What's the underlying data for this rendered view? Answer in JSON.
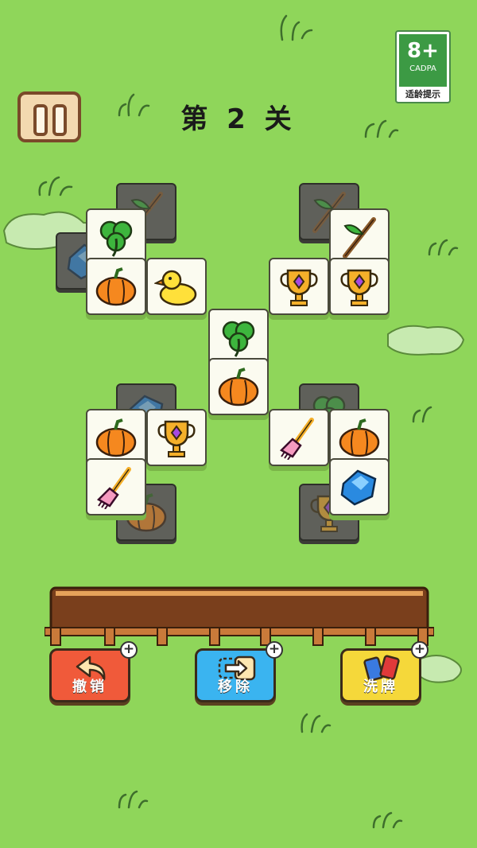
{
  "level": {
    "title": "第 2 关"
  },
  "age_rating": {
    "badge": "8+",
    "org": "CADPA",
    "tip": "适龄提示"
  },
  "pause_button": {
    "icon": "pause-icon"
  },
  "tray": {
    "label": "",
    "slots_filled": 0
  },
  "actions": [
    {
      "id": "undo",
      "label": "撤销",
      "icon": "undo-arrow-icon",
      "color": "#f05a3a"
    },
    {
      "id": "remove",
      "label": "移除",
      "icon": "remove-arrow-icon",
      "color": "#3ab4f0"
    },
    {
      "id": "shuffle",
      "label": "洗牌",
      "icon": "cards-icon",
      "color": "#f5d83a"
    }
  ],
  "tiles": [
    {
      "item": "twig",
      "state": "covered"
    },
    {
      "item": "gem",
      "state": "covered"
    },
    {
      "item": "clover",
      "state": "open"
    },
    {
      "item": "pumpkin",
      "state": "open"
    },
    {
      "item": "duck",
      "state": "open"
    },
    {
      "item": "twig",
      "state": "covered"
    },
    {
      "item": "twig",
      "state": "open"
    },
    {
      "item": "trophy",
      "state": "open"
    },
    {
      "item": "trophy",
      "state": "open"
    },
    {
      "item": "clover",
      "state": "open"
    },
    {
      "item": "pumpkin",
      "state": "open"
    },
    {
      "item": "gem",
      "state": "covered"
    },
    {
      "item": "clover",
      "state": "covered"
    },
    {
      "item": "pumpkin",
      "state": "open"
    },
    {
      "item": "trophy",
      "state": "open"
    },
    {
      "item": "broom",
      "state": "open"
    },
    {
      "item": "pumpkin",
      "state": "open"
    },
    {
      "item": "broom",
      "state": "open"
    },
    {
      "item": "gem",
      "state": "open"
    },
    {
      "item": "pumpkin",
      "state": "covered"
    },
    {
      "item": "trophy",
      "state": "covered"
    }
  ]
}
